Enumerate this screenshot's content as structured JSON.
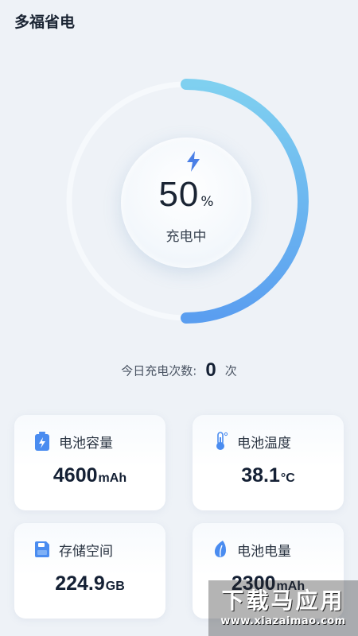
{
  "app": {
    "title": "多福省电"
  },
  "battery": {
    "level_percent": 50,
    "value": "50",
    "unit": "%",
    "status": "充电中",
    "ring_gradient": [
      "#7fd0f0",
      "#5a9ef0"
    ],
    "track_color": "#f6f9fc"
  },
  "charge_count": {
    "label": "今日充电次数:",
    "value": "0",
    "unit": "次"
  },
  "cards": [
    {
      "label": "电池容量",
      "value": "4600",
      "unit": "mAh",
      "icon": "battery-icon",
      "icon_color": "#4a8cf0"
    },
    {
      "label": "电池温度",
      "value": "38.1",
      "unit": "°C",
      "icon": "thermometer-icon",
      "icon_color": "#4a8cf0"
    },
    {
      "label": "存储空间",
      "value": "224.9",
      "unit": "GB",
      "icon": "storage-icon",
      "icon_color": "#4a8cf0"
    },
    {
      "label": "电池电量",
      "value": "2300",
      "unit": "mAh",
      "icon": "leaf-icon",
      "icon_color": "#4a8cf0"
    }
  ],
  "watermark": {
    "text": "下载马应用",
    "url": "www.xiazaimao.com"
  }
}
